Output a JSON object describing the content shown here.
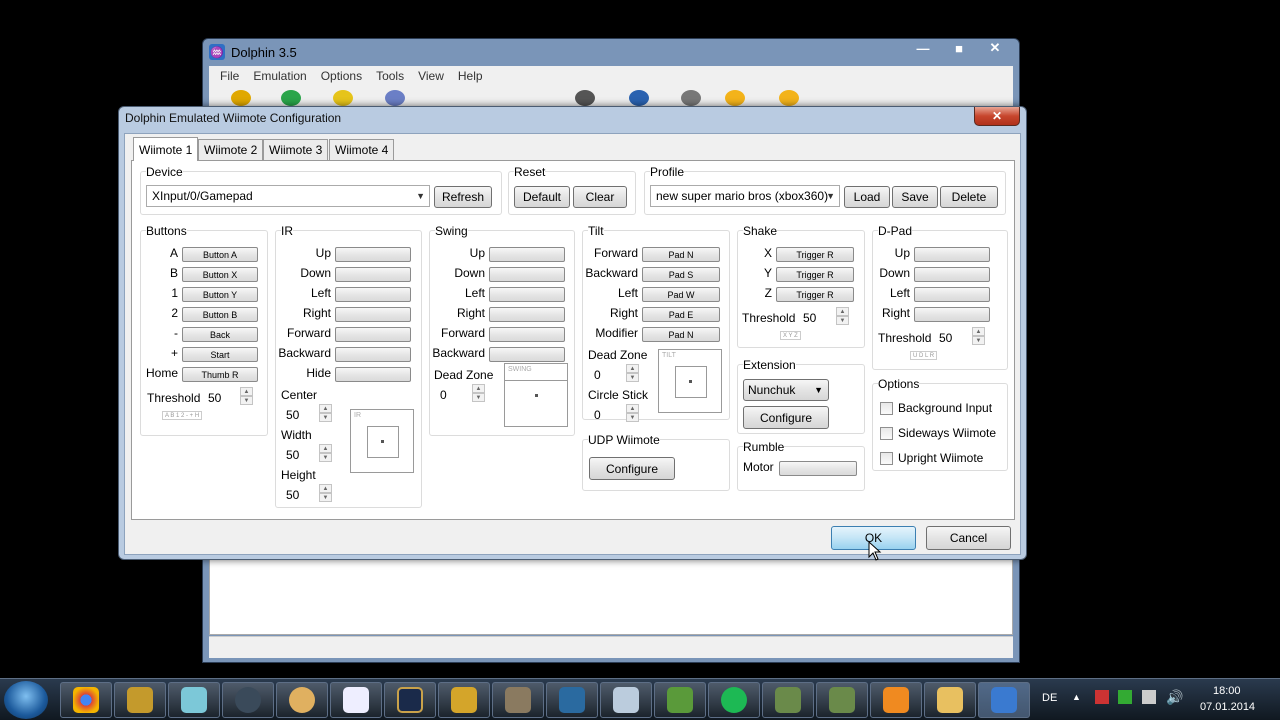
{
  "main_window": {
    "title": "Dolphin 3.5",
    "controls": {
      "minimize": "—",
      "maximize": "■",
      "close": "✕"
    },
    "menu": [
      "File",
      "Emulation",
      "Options",
      "Tools",
      "View",
      "Help"
    ]
  },
  "dialog": {
    "title": "Dolphin Emulated Wiimote Configuration",
    "close": "✕",
    "tabs": [
      "Wiimote 1",
      "Wiimote 2",
      "Wiimote 3",
      "Wiimote 4"
    ],
    "active_tab": "Wiimote 1",
    "device": {
      "label": "Device",
      "value": "XInput/0/Gamepad",
      "refresh": "Refresh"
    },
    "reset": {
      "label": "Reset",
      "default": "Default",
      "clear": "Clear"
    },
    "profile": {
      "label": "Profile",
      "value": "new super mario bros (xbox360)",
      "load": "Load",
      "save": "Save",
      "delete": "Delete"
    },
    "buttons": {
      "title": "Buttons",
      "rows": [
        {
          "key": "A",
          "mapping": "Button A"
        },
        {
          "key": "B",
          "mapping": "Button X"
        },
        {
          "key": "1",
          "mapping": "Button Y"
        },
        {
          "key": "2",
          "mapping": "Button B"
        },
        {
          "key": "-",
          "mapping": "Back"
        },
        {
          "key": "+",
          "mapping": "Start"
        },
        {
          "key": "Home",
          "mapping": "Thumb R"
        }
      ],
      "threshold_label": "Threshold",
      "threshold": "50",
      "indicator": "A B 1 2 - + H"
    },
    "ir": {
      "title": "IR",
      "rows": [
        "Up",
        "Down",
        "Left",
        "Right",
        "Forward",
        "Backward",
        "Hide"
      ],
      "center_label": "Center",
      "center": "50",
      "width_label": "Width",
      "width": "50",
      "height_label": "Height",
      "height": "50",
      "box_caption": "IR"
    },
    "swing": {
      "title": "Swing",
      "rows": [
        "Up",
        "Down",
        "Left",
        "Right",
        "Forward",
        "Backward"
      ],
      "deadzone_label": "Dead Zone",
      "deadzone": "0",
      "box_caption": "SWING"
    },
    "tilt": {
      "title": "Tilt",
      "rows": [
        {
          "key": "Forward",
          "mapping": "Pad N"
        },
        {
          "key": "Backward",
          "mapping": "Pad S"
        },
        {
          "key": "Left",
          "mapping": "Pad W"
        },
        {
          "key": "Right",
          "mapping": "Pad E"
        },
        {
          "key": "Modifier",
          "mapping": "Pad N"
        }
      ],
      "deadzone_label": "Dead Zone",
      "deadzone": "0",
      "circle_label": "Circle Stick",
      "circle": "0",
      "box_caption": "TILT"
    },
    "udp": {
      "title": "UDP Wiimote",
      "configure": "Configure"
    },
    "shake": {
      "title": "Shake",
      "rows": [
        {
          "key": "X",
          "mapping": "Trigger R"
        },
        {
          "key": "Y",
          "mapping": "Trigger R"
        },
        {
          "key": "Z",
          "mapping": "Trigger R"
        }
      ],
      "threshold_label": "Threshold",
      "threshold": "50",
      "indicator": "X Y Z"
    },
    "extension": {
      "title": "Extension",
      "value": "Nunchuk",
      "configure": "Configure"
    },
    "rumble": {
      "title": "Rumble",
      "motor_label": "Motor"
    },
    "dpad": {
      "title": "D-Pad",
      "rows": [
        "Up",
        "Down",
        "Left",
        "Right"
      ],
      "threshold_label": "Threshold",
      "threshold": "50",
      "indicator": "U D L R"
    },
    "options": {
      "title": "Options",
      "items": [
        "Background Input",
        "Sideways Wiimote",
        "Upright Wiimote"
      ]
    },
    "ok": "OK",
    "cancel": "Cancel"
  },
  "taskbar": {
    "language": "DE",
    "time": "18:00",
    "date": "07.01.2014"
  },
  "colors": {
    "titlebar": "#b9cbe1",
    "close_red": "#c7462d",
    "ok_blue": "#98d1ef",
    "taskbar": "#1c2836"
  }
}
